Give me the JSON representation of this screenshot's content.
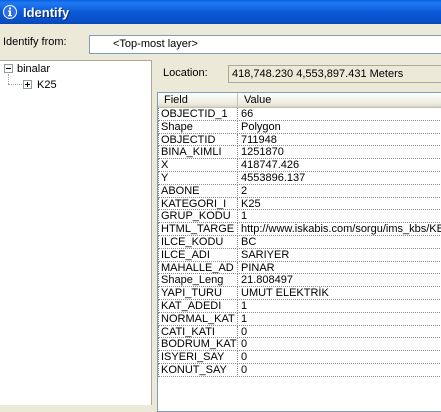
{
  "window": {
    "title": "Identify",
    "title_icon": "info-icon",
    "title_bar_color": "#0a5fe0"
  },
  "identify_from": {
    "label": "Identify from:",
    "value": "<Top-most layer>"
  },
  "tree": {
    "root_label": "binalar",
    "root_toggle": "minus",
    "child_label": "K25",
    "child_toggle": "plus"
  },
  "location": {
    "label": "Location:",
    "value": "418,748.230  4,553,897.431 Meters"
  },
  "grid": {
    "columns": [
      "Field",
      "Value"
    ],
    "rows": [
      {
        "field": "OBJECTID_1",
        "value": "66"
      },
      {
        "field": "Shape",
        "value": "Polygon"
      },
      {
        "field": "OBJECTID",
        "value": "711948"
      },
      {
        "field": "BINA_KIMLI",
        "value": "1251870"
      },
      {
        "field": "X",
        "value": "418747.426"
      },
      {
        "field": "Y",
        "value": "4553896.137"
      },
      {
        "field": "ABONE",
        "value": "2"
      },
      {
        "field": "KATEGORI_I",
        "value": "K25"
      },
      {
        "field": "GRUP_KODU",
        "value": "1"
      },
      {
        "field": "HTML_TARGE",
        "value": "http://www.iskabis.com/sorgu/ims_kbs/KB"
      },
      {
        "field": "ILCE_KODU",
        "value": "BC"
      },
      {
        "field": "ILCE_ADI",
        "value": "SARIYER"
      },
      {
        "field": "MAHALLE_AD",
        "value": "PINAR"
      },
      {
        "field": "Shape_Leng",
        "value": "21.808497"
      },
      {
        "field": "YAPI_TURU",
        "value": "UMUT ELEKTRİK"
      },
      {
        "field": "KAT_ADEDI",
        "value": "1"
      },
      {
        "field": "NORMAL_KAT",
        "value": "1"
      },
      {
        "field": "CATI_KATI",
        "value": "0"
      },
      {
        "field": "BODRUM_KAT",
        "value": "0"
      },
      {
        "field": "ISYERI_SAY",
        "value": "0"
      },
      {
        "field": "KONUT_SAY",
        "value": "0"
      }
    ]
  }
}
